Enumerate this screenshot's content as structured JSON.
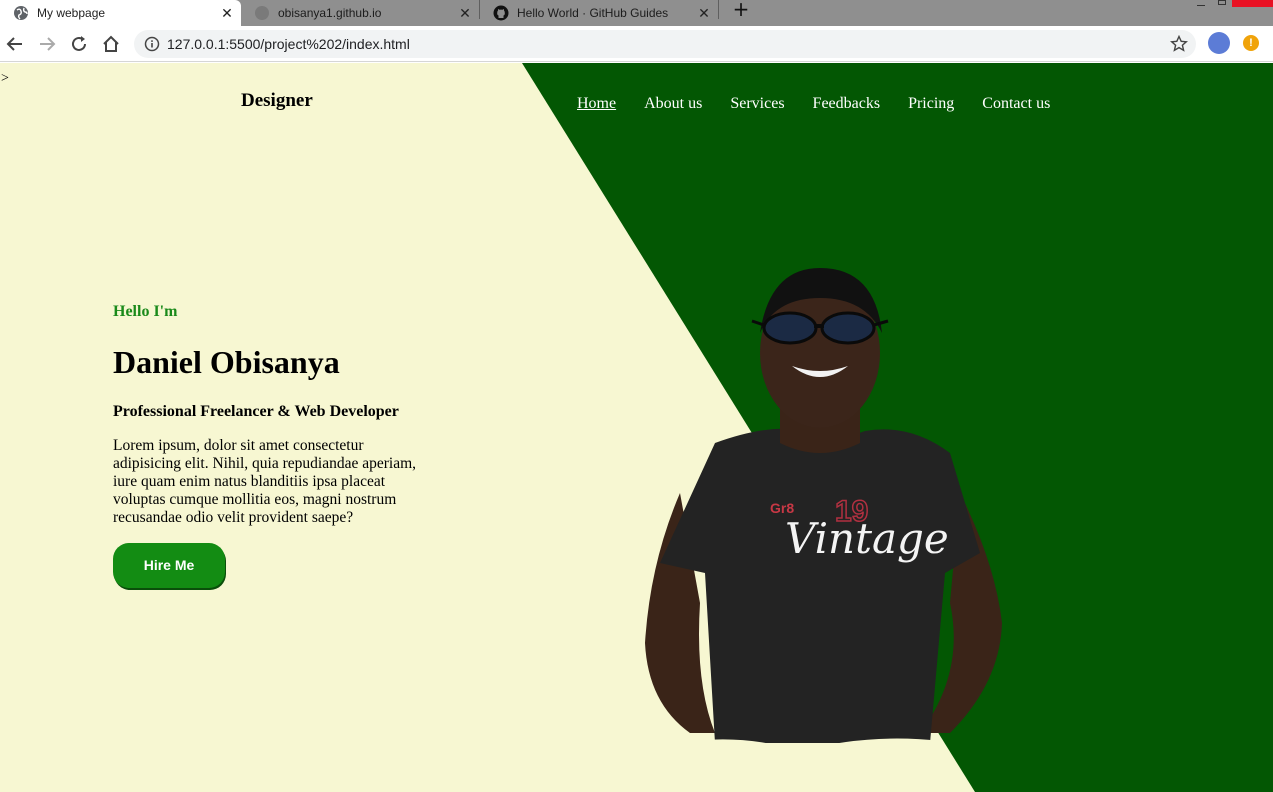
{
  "browser": {
    "tabs": [
      {
        "title": "My webpage",
        "active": true
      },
      {
        "title": "obisanya1.github.io",
        "active": false
      },
      {
        "title": "Hello World · GitHub Guides",
        "active": false
      }
    ],
    "close_glyph": "✕",
    "new_tab_glyph": "+",
    "url": "127.0.0.1:5500/project%202/index.html",
    "extension_badge": "!"
  },
  "page": {
    "stray_text": ">",
    "logo": "Designer",
    "nav": [
      "Home",
      "About us",
      "Services",
      "Feedbacks",
      "Pricing",
      "Contact us"
    ],
    "hero": {
      "greeting": "Hello I'm",
      "name": "Daniel Obisanya",
      "role": "Professional Freelancer & Web Developer",
      "bio": "Lorem ipsum, dolor sit amet consectetur adipisicing elit. Nihil, quia repudiandae aperiam, iure quam enim natus blanditiis ipsa placeat voluptas cumque mollitia eos, magni nostrum recusandae odio velit provident saepe?",
      "button": "Hire Me"
    },
    "shirt_text": "Vintage",
    "colors": {
      "cream": "#f7f7d2",
      "dark_green": "#035703",
      "accent_green": "#138c13"
    }
  }
}
